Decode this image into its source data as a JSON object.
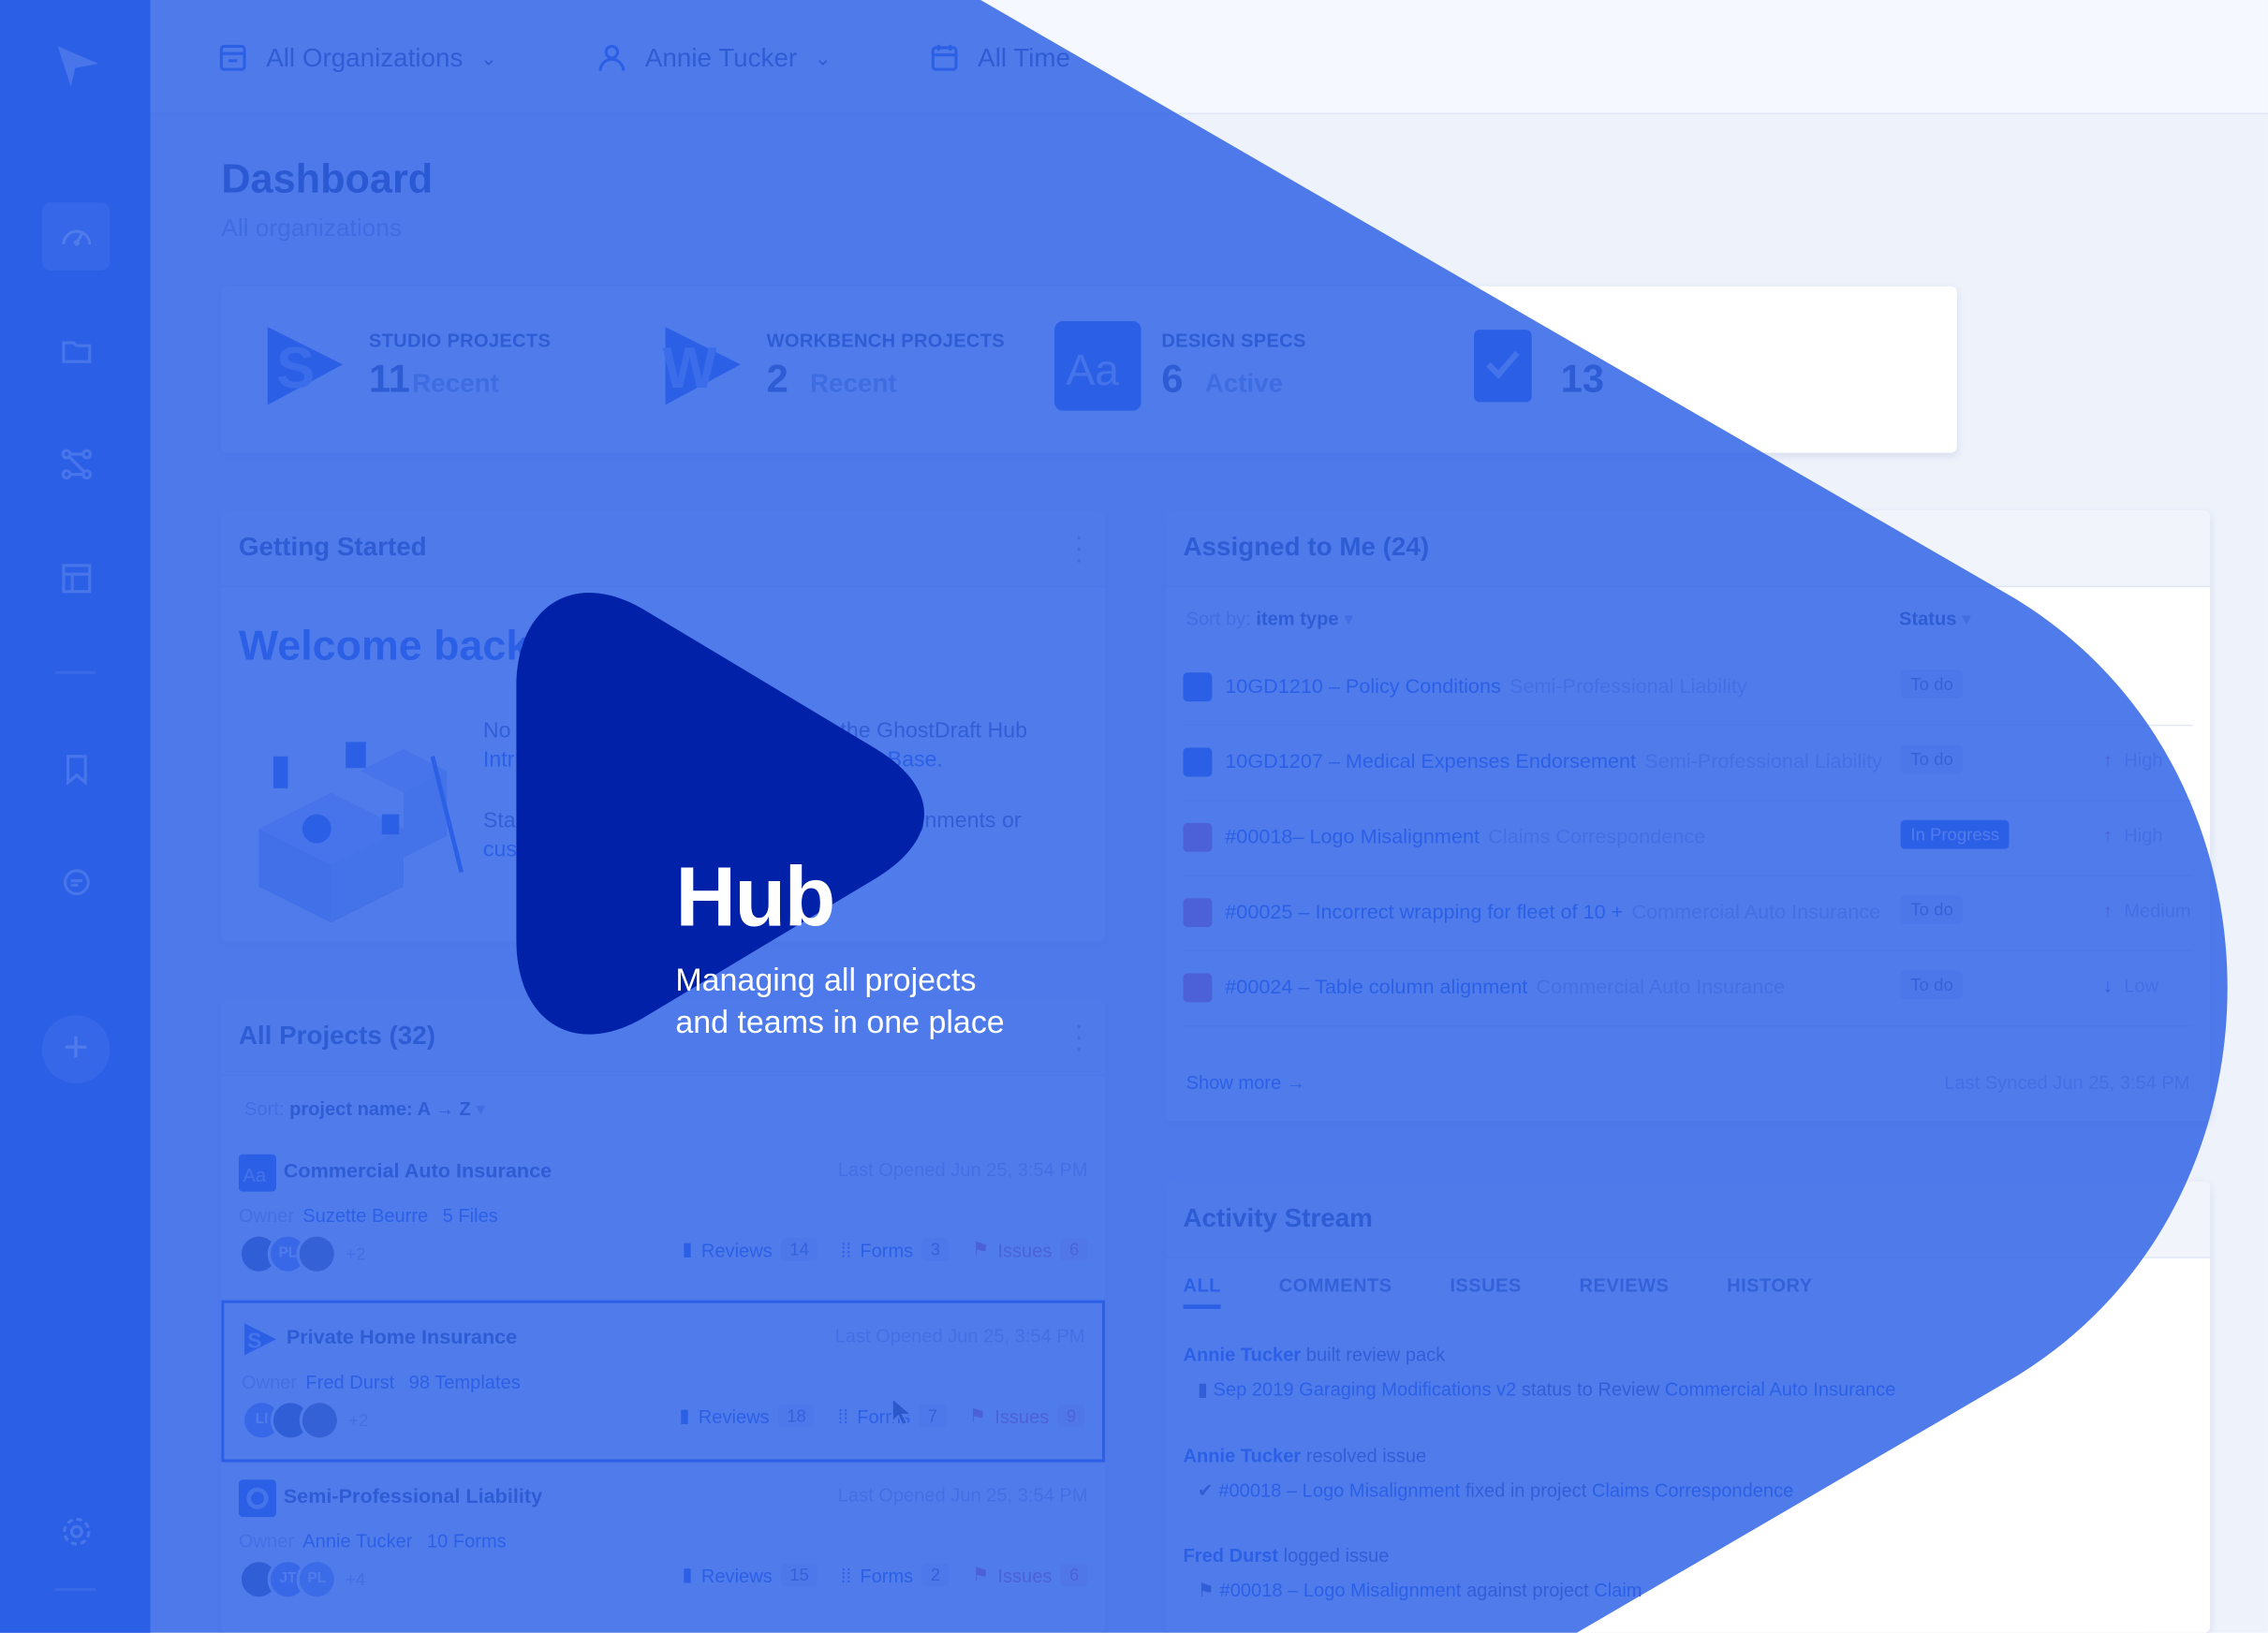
{
  "hero": {
    "title": "Hub",
    "subtitle_line1": "Managing all projects",
    "subtitle_line2": "and teams in one place"
  },
  "topbar": {
    "org_filter": "All Organizations",
    "user_filter": "Annie Tucker",
    "time_filter": "All Time"
  },
  "page": {
    "title": "Dashboard",
    "subtitle": "All organizations"
  },
  "stats": [
    {
      "label": "STUDIO PROJECTS",
      "count": "11",
      "word": "Recent"
    },
    {
      "label": "WORKBENCH PROJECTS",
      "count": "2",
      "word": "Recent"
    },
    {
      "label": "DESIGN SPECS",
      "count": "6",
      "word": "Active"
    },
    {
      "label": "",
      "count": "13",
      "word": ""
    }
  ],
  "getting_started": {
    "title": "Getting Started",
    "welcome": "Welcome back",
    "line1a": "No",
    "line1b": "the GhostDraft Hub",
    "line2a": "Intr",
    "line2b": "e Base.",
    "line3a": "Sta",
    "line3b": "gnments or",
    "line4a": "cus"
  },
  "all_projects": {
    "title": "All Projects (32)",
    "sort_prefix": "Sort:",
    "sort_value": "project name: A → Z",
    "owner_label": "Owner",
    "reviews_label": "Reviews",
    "forms_label": "Forms",
    "issues_label": "Issues",
    "items": [
      {
        "name": "Commercial Auto Insurance",
        "opened": "Last Opened Jun 25, 3:54 PM",
        "owner": "Suzette Beurre",
        "files": "5 Files",
        "av": [
          "",
          "PL",
          ""
        ],
        "more": "+2",
        "reviews": "14",
        "forms": "3",
        "issues": "6"
      },
      {
        "name": "Private Home Insurance",
        "opened": "Last Opened Jun 25, 3:54 PM",
        "owner": "Fred Durst",
        "files": "98 Templates",
        "av": [
          "LI",
          "",
          ""
        ],
        "more": "+2",
        "reviews": "18",
        "forms": "7",
        "issues": "9"
      },
      {
        "name": "Semi-Professional Liability",
        "opened": "Last Opened Jun 25, 3:54 PM",
        "owner": "Annie Tucker",
        "files": "10 Forms",
        "av": [
          "",
          "JT",
          "PL"
        ],
        "more": "+4",
        "reviews": "15",
        "forms": "2",
        "issues": "6"
      }
    ]
  },
  "assigned": {
    "title": "Assigned to Me (24)",
    "sort_prefix": "Sort by:",
    "sort_value": "item type",
    "status_header": "Status",
    "items": [
      {
        "title": "10GD1210 – Policy Conditions",
        "sub": "Semi-Professional Liability",
        "status": "To do",
        "priority": ""
      },
      {
        "title": "10GD1207 – Medical Expenses Endorsement",
        "sub": "Semi-Professional Liability",
        "status": "To do",
        "priority": "High"
      },
      {
        "title": "#00018– Logo Misalignment",
        "sub": "Claims Correspondence",
        "status": "In Progress",
        "priority": "High"
      },
      {
        "title": "#00025 – Incorrect wrapping for fleet of 10 +",
        "sub": "Commercial Auto Insurance",
        "status": "To do",
        "priority": "Medium"
      },
      {
        "title": "#00024 – Table column alignment",
        "sub": "Commercial Auto Insurance",
        "status": "To do",
        "priority": "Low"
      }
    ],
    "show_more": "Show more",
    "synced": "Last Synced Jun 25, 3:54 PM"
  },
  "activity": {
    "title": "Activity Stream",
    "tabs": [
      "ALL",
      "COMMENTS",
      "ISSUES",
      "REVIEWS",
      "HISTORY"
    ],
    "e1_user": "Annie Tucker",
    "e1_action": "built review pack",
    "e1_link": "Sep 2019 Garaging Modifications v2",
    "e1_mid": "status to Review",
    "e1_proj": "Commercial Auto Insurance",
    "e2_user": "Annie Tucker",
    "e2_action": "resolved issue",
    "e2_link": "#00018 – Logo Misalignment",
    "e2_mid": "fixed in project",
    "e2_proj": "Claims Correspondence",
    "e3_user": "Fred Durst",
    "e3_action": "logged issue",
    "e3_link": "#00018 – Logo Misalignment",
    "e3_mid": "against project",
    "e3_proj": "Claim"
  },
  "colors": {
    "brand": "#1e55e6",
    "overlay": "#3a6ae8",
    "play": "#0121a8"
  }
}
